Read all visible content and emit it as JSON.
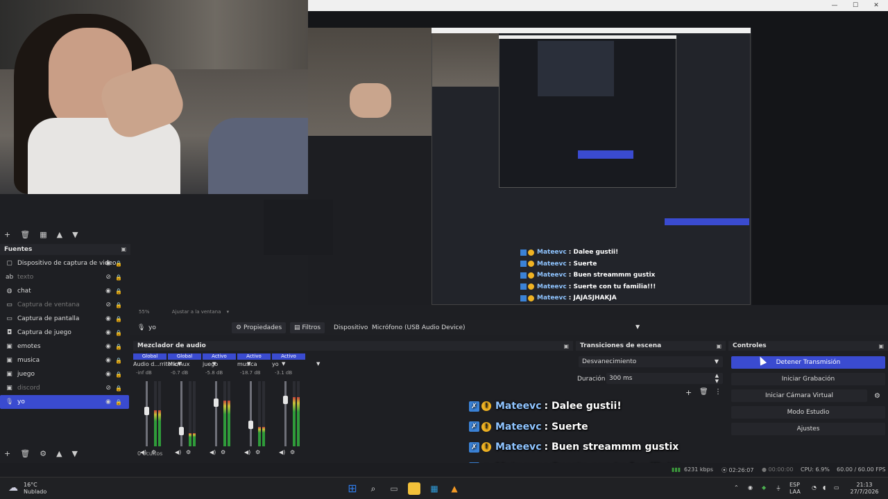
{
  "window_controls": {
    "minimize": "—",
    "maximize": "☐",
    "close": "✕"
  },
  "toolbar_icons": [
    "+",
    "🗑",
    "▦",
    "▲",
    "▼"
  ],
  "sources": {
    "title": "Fuentes",
    "items": [
      {
        "label": "Dispositivo de captura de video",
        "icon": "camera-icon",
        "glyph": "▢",
        "visible": true,
        "dim": false,
        "selected": false
      },
      {
        "label": "texto",
        "icon": "text-icon",
        "glyph": "ab",
        "visible": false,
        "dim": true,
        "selected": false
      },
      {
        "label": "chat",
        "icon": "globe-icon",
        "glyph": "◍",
        "visible": true,
        "dim": false,
        "selected": false
      },
      {
        "label": "Captura de ventana",
        "icon": "window-icon",
        "glyph": "▭",
        "visible": false,
        "dim": true,
        "selected": false
      },
      {
        "label": "Captura de pantalla",
        "icon": "monitor-icon",
        "glyph": "▭",
        "visible": true,
        "dim": false,
        "selected": false
      },
      {
        "label": "Captura de juego",
        "icon": "gamepad-icon",
        "glyph": "◘",
        "visible": true,
        "dim": false,
        "selected": false
      },
      {
        "label": "emotes",
        "icon": "image-icon",
        "glyph": "▣",
        "visible": true,
        "dim": false,
        "selected": false
      },
      {
        "label": "musica",
        "icon": "image-icon",
        "glyph": "▣",
        "visible": true,
        "dim": false,
        "selected": false
      },
      {
        "label": "juego",
        "icon": "image-icon",
        "glyph": "▣",
        "visible": true,
        "dim": false,
        "selected": false
      },
      {
        "label": "discord",
        "icon": "image-icon",
        "glyph": "▣",
        "visible": false,
        "dim": true,
        "selected": false
      },
      {
        "label": "yo",
        "icon": "microphone-icon",
        "glyph": "🎙",
        "visible": true,
        "dim": false,
        "selected": true
      }
    ]
  },
  "preview_bar": {
    "zoom": "55%",
    "fit": "Ajustar a la ventana"
  },
  "source_bar": {
    "source_name": "yo",
    "properties": "Propiedades",
    "filters": "Filtros",
    "device_label": "Dispositivo",
    "device_value": "Micrófono (USB Audio Device)"
  },
  "mixer": {
    "title": "Mezclador de audio",
    "hidden_count": "0 ocultos",
    "channels": [
      {
        "header": "Global",
        "name": "Audio d...rritorio",
        "db": "-inf dB",
        "header_color": "#3a4bd0",
        "level": 0.55
      },
      {
        "header": "Global",
        "name": "Mic/Aux",
        "db": "-0.7 dB",
        "header_color": "#3a4bd0",
        "level": 0.2
      },
      {
        "header": "Activo",
        "name": "juego",
        "db": "-5.8 dB",
        "header_color": "#3a4bd0",
        "level": 0.7
      },
      {
        "header": "Activo",
        "name": "musica",
        "db": "-18.7 dB",
        "header_color": "#3a4bd0",
        "level": 0.3
      },
      {
        "header": "Activo",
        "name": "yo",
        "db": "-3.1 dB",
        "header_color": "#3a4bd0",
        "level": 0.75
      }
    ]
  },
  "transitions": {
    "title": "Transiciones de escena",
    "selected": "Desvanecimiento",
    "duration_label": "Duración",
    "duration_value": "300 ms"
  },
  "controls": {
    "title": "Controles",
    "stop_stream": "Detener Transmisión",
    "start_recording": "Iniciar Grabación",
    "start_virtual_cam": "Iniciar Cámara Virtual",
    "studio_mode": "Modo Estudio",
    "settings": "Ajustes"
  },
  "chat": [
    {
      "user": "Mateevc",
      "message": ": Dalee gustii!"
    },
    {
      "user": "Mateevc",
      "message": ": Suerte"
    },
    {
      "user": "Mateevc",
      "message": ": Buen streammm gustix"
    },
    {
      "user": "Mateevc",
      "message": ": Suerte con tu familia!!!"
    },
    {
      "user": "Mateevc",
      "message": ": JAJASJHAKJA"
    }
  ],
  "status": {
    "bitrate": "6231 kbps",
    "stream_time": "02:26:07",
    "rec_time": "00:00:00",
    "cpu": "CPU: 6.9%",
    "fps": "60.00 / 60.00 FPS"
  },
  "taskbar": {
    "weather_temp": "16°C",
    "weather_desc": "Nublado",
    "lang": "ESP",
    "region": "LAA",
    "time": "21:13",
    "date": "27/7/2026"
  }
}
